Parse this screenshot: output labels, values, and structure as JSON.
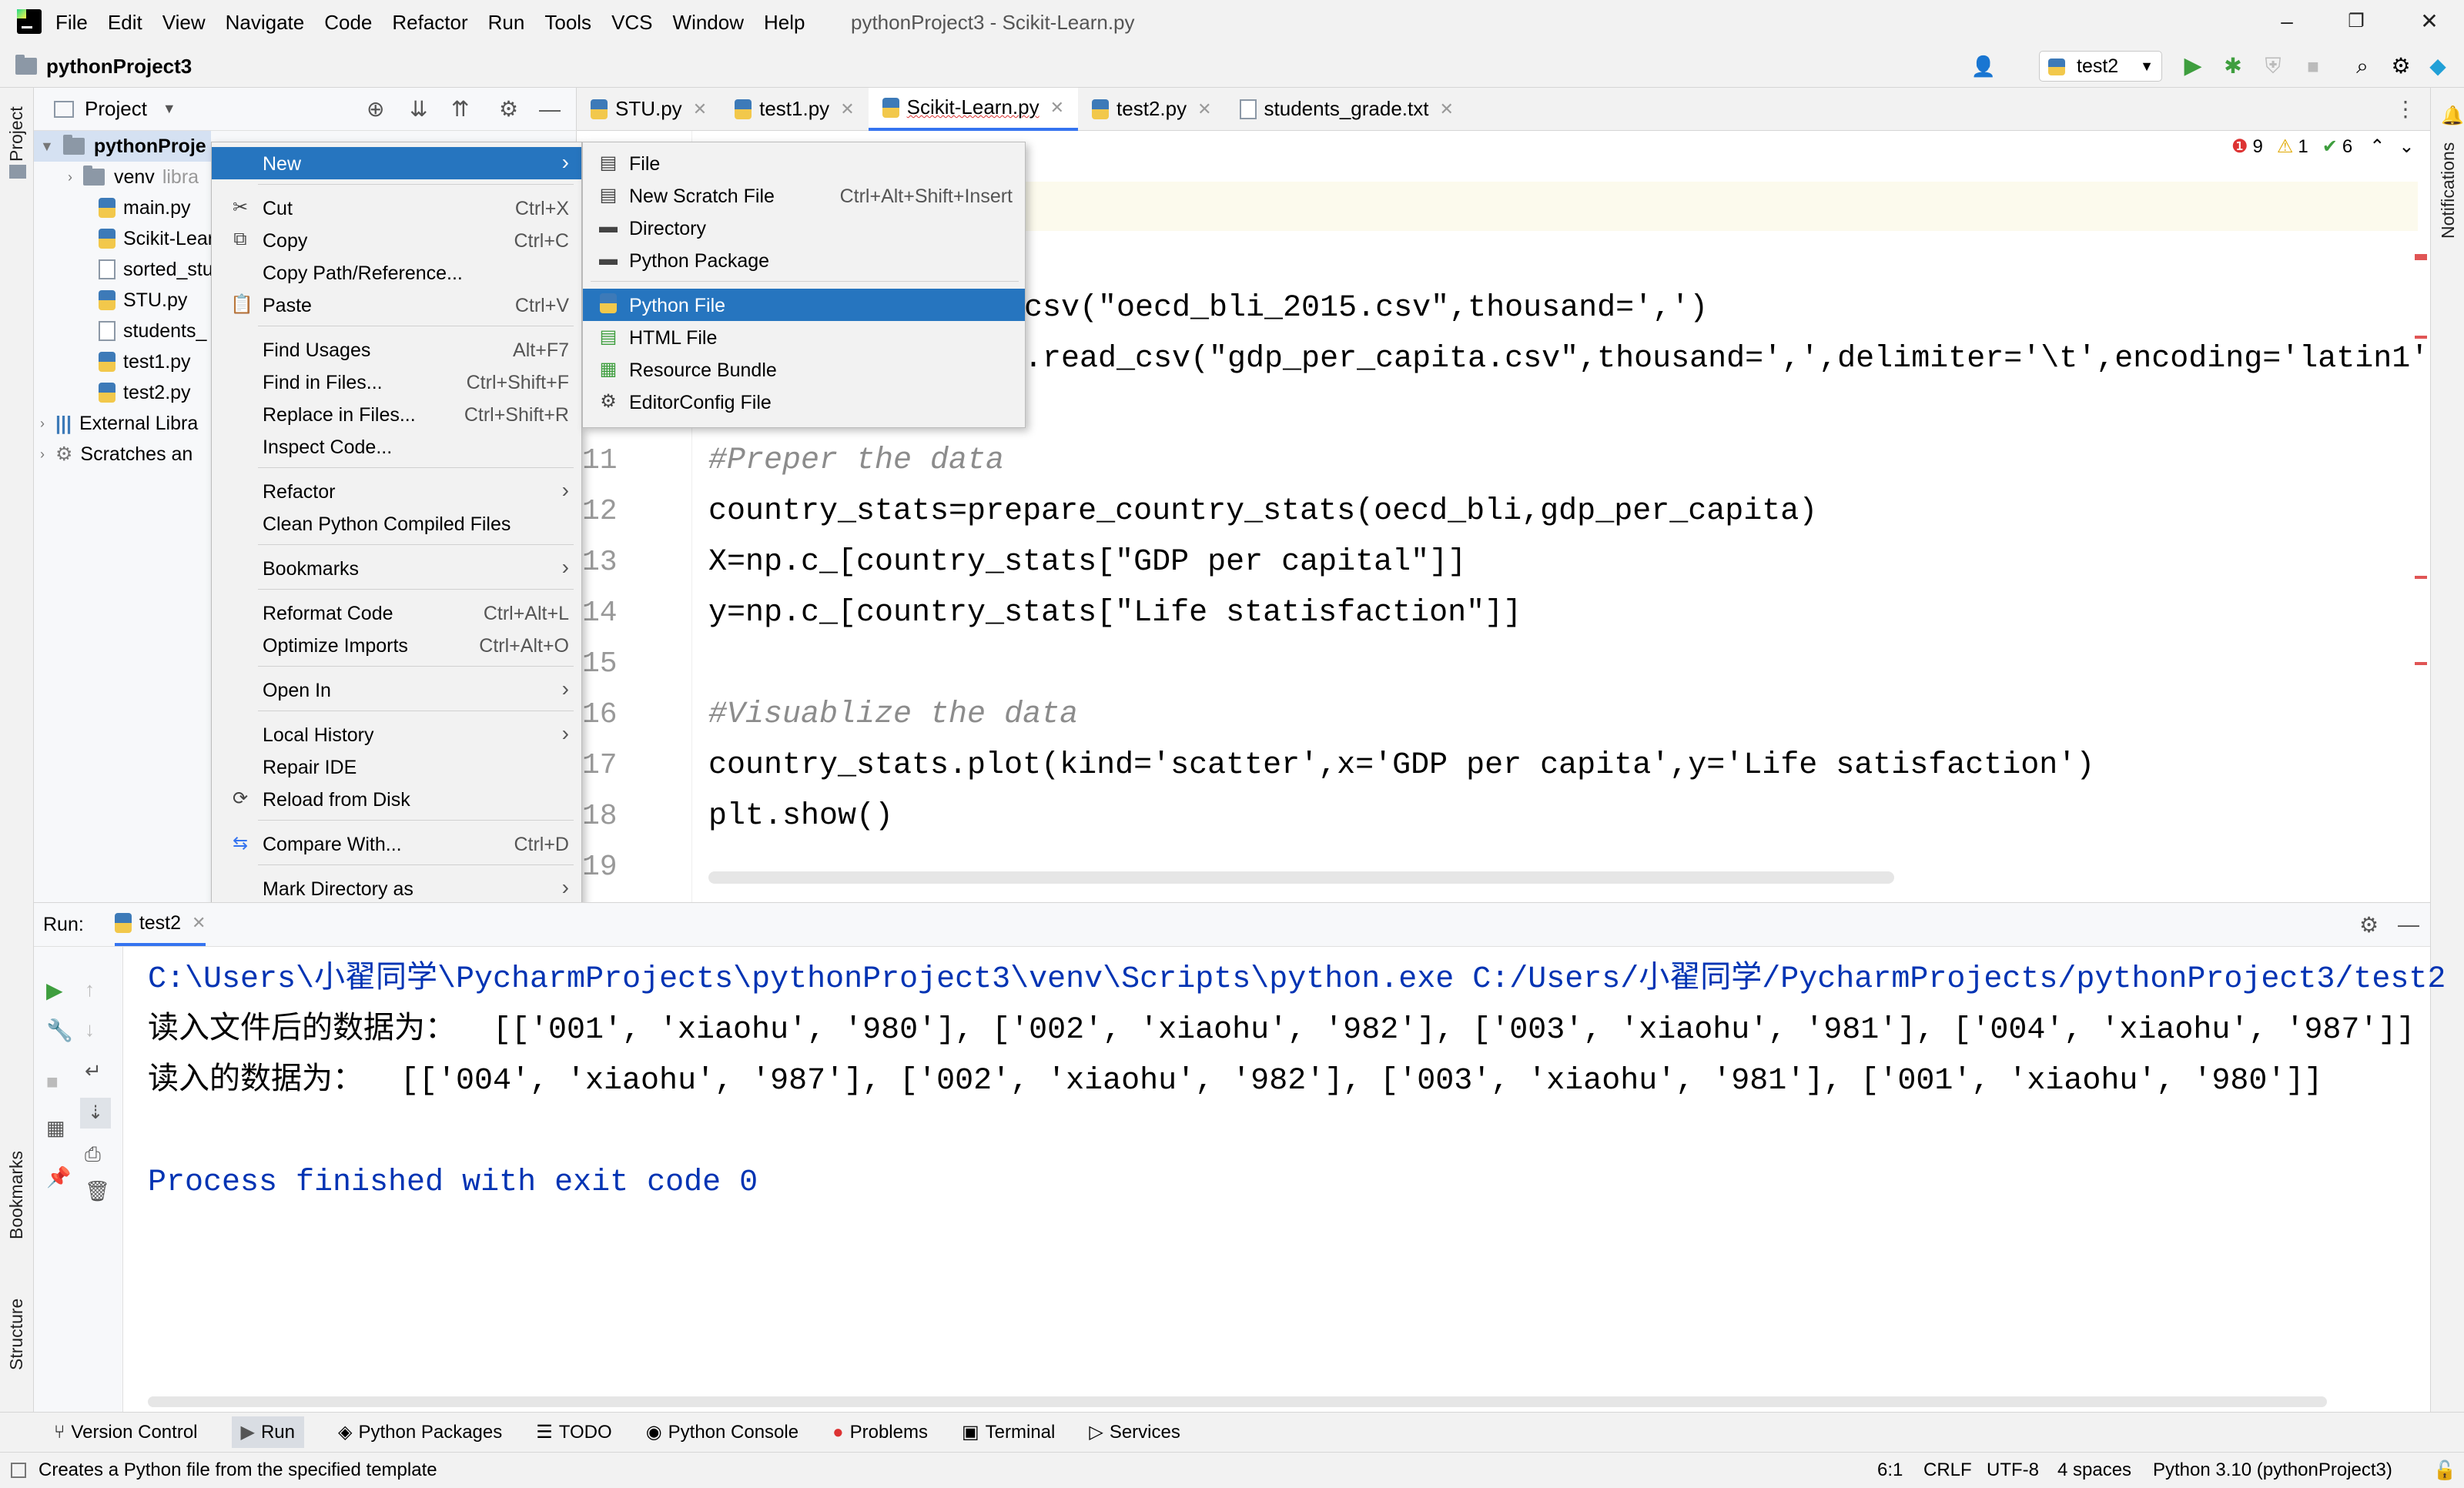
{
  "menubar": {
    "items": [
      "File",
      "Edit",
      "View",
      "Navigate",
      "Code",
      "Refactor",
      "Run",
      "Tools",
      "VCS",
      "Window",
      "Help"
    ],
    "title": "pythonProject3 - Scikit-Learn.py"
  },
  "toolbar": {
    "project": "pythonProject3",
    "run_config": "test2"
  },
  "project_panel": {
    "title": "Project",
    "items": [
      {
        "label": "pythonProje",
        "suffix": ""
      },
      {
        "label": "venv",
        "suffix": "libra"
      },
      {
        "label": "main.py",
        "suffix": ""
      },
      {
        "label": "Scikit-Lear",
        "suffix": ""
      },
      {
        "label": "sorted_stu",
        "suffix": ""
      },
      {
        "label": "STU.py",
        "suffix": ""
      },
      {
        "label": "students_",
        "suffix": ""
      },
      {
        "label": "test1.py",
        "suffix": ""
      },
      {
        "label": "test2.py",
        "suffix": ""
      },
      {
        "label": "External Libra",
        "suffix": ""
      },
      {
        "label": "Scratches an",
        "suffix": ""
      }
    ]
  },
  "tabs": [
    {
      "label": "STU.py"
    },
    {
      "label": "test1.py"
    },
    {
      "label": "Scikit-Learn.py"
    },
    {
      "label": "test2.py"
    },
    {
      "label": "students_grade.txt"
    }
  ],
  "inspections": {
    "errors": "9",
    "warnings": "1",
    "ok": "6"
  },
  "editor": {
    "partial_line1": "csv(\"oecd_bli_2015.csv\",thousand=',')",
    "partial_line2": ".read_csv(\"gdp_per_capita.csv\",thousand=',',delimiter='\\t',encoding='latin1'",
    "line_numbers": [
      "11",
      "12",
      "13",
      "14",
      "15",
      "16",
      "17",
      "18",
      "19"
    ],
    "lines": [
      "#Preper the data",
      "country_stats=prepare_country_stats(oecd_bli,gdp_per_capita)",
      "X=np.c_[country_stats[\"GDP per capital\"]]",
      "y=np.c_[country_stats[\"Life statisfaction\"]]",
      "",
      "#Visuablize the data",
      "country_stats.plot(kind='scatter',x='GDP per capita',y='Life satisfaction')",
      "plt.show()",
      ""
    ]
  },
  "context_menu": {
    "items": [
      {
        "label": "New",
        "shortcut": "",
        "arrow": "›"
      },
      {
        "label": "Cut",
        "shortcut": "Ctrl+X"
      },
      {
        "label": "Copy",
        "shortcut": "Ctrl+C"
      },
      {
        "label": "Copy Path/Reference...",
        "shortcut": ""
      },
      {
        "label": "Paste",
        "shortcut": "Ctrl+V"
      },
      {
        "label": "Find Usages",
        "shortcut": "Alt+F7"
      },
      {
        "label": "Find in Files...",
        "shortcut": "Ctrl+Shift+F"
      },
      {
        "label": "Replace in Files...",
        "shortcut": "Ctrl+Shift+R"
      },
      {
        "label": "Inspect Code...",
        "shortcut": ""
      },
      {
        "label": "Refactor",
        "shortcut": "",
        "arrow": "›"
      },
      {
        "label": "Clean Python Compiled Files",
        "shortcut": ""
      },
      {
        "label": "Bookmarks",
        "shortcut": "",
        "arrow": "›"
      },
      {
        "label": "Reformat Code",
        "shortcut": "Ctrl+Alt+L"
      },
      {
        "label": "Optimize Imports",
        "shortcut": "Ctrl+Alt+O"
      },
      {
        "label": "Open In",
        "shortcut": "",
        "arrow": "›"
      },
      {
        "label": "Local History",
        "shortcut": "",
        "arrow": "›"
      },
      {
        "label": "Repair IDE",
        "shortcut": ""
      },
      {
        "label": "Reload from Disk",
        "shortcut": ""
      },
      {
        "label": "Compare With...",
        "shortcut": "Ctrl+D"
      },
      {
        "label": "Mark Directory as",
        "shortcut": "",
        "arrow": "›"
      }
    ]
  },
  "submenu": {
    "items": [
      {
        "label": "File",
        "shortcut": ""
      },
      {
        "label": "New Scratch File",
        "shortcut": "Ctrl+Alt+Shift+Insert"
      },
      {
        "label": "Directory",
        "shortcut": ""
      },
      {
        "label": "Python Package",
        "shortcut": ""
      },
      {
        "label": "Python File",
        "shortcut": ""
      },
      {
        "label": "HTML File",
        "shortcut": ""
      },
      {
        "label": "Resource Bundle",
        "shortcut": ""
      },
      {
        "label": "EditorConfig File",
        "shortcut": ""
      }
    ]
  },
  "run_panel": {
    "label": "Run:",
    "tab": "test2"
  },
  "console": {
    "lines": [
      "C:\\Users\\小翟同学\\PycharmProjects\\pythonProject3\\venv\\Scripts\\python.exe C:/Users/小翟同学/PycharmProjects/pythonProject3/test2",
      "读入文件后的数据为：  [['001', 'xiaohu', '980'], ['002', 'xiaohu', '982'], ['003', 'xiaohu', '981'], ['004', 'xiaohu', '987']]",
      "读入的数据为：  [['004', 'xiaohu', '987'], ['002', 'xiaohu', '982'], ['003', 'xiaohu', '981'], ['001', 'xiaohu', '980']]",
      "",
      "Process finished with exit code 0"
    ]
  },
  "bottom_tools": [
    "Version Control",
    "Run",
    "Python Packages",
    "TODO",
    "Python Console",
    "Problems",
    "Terminal",
    "Services"
  ],
  "status": {
    "message": "Creates a Python file from the specified template",
    "position": "6:1",
    "line_sep": "CRLF",
    "encoding": "UTF-8",
    "indent": "4 spaces",
    "interpreter": "Python 3.10 (pythonProject3)"
  },
  "side_labels": {
    "project": "Project",
    "bookmarks": "Bookmarks",
    "structure": "Structure",
    "notifications": "Notifications"
  }
}
